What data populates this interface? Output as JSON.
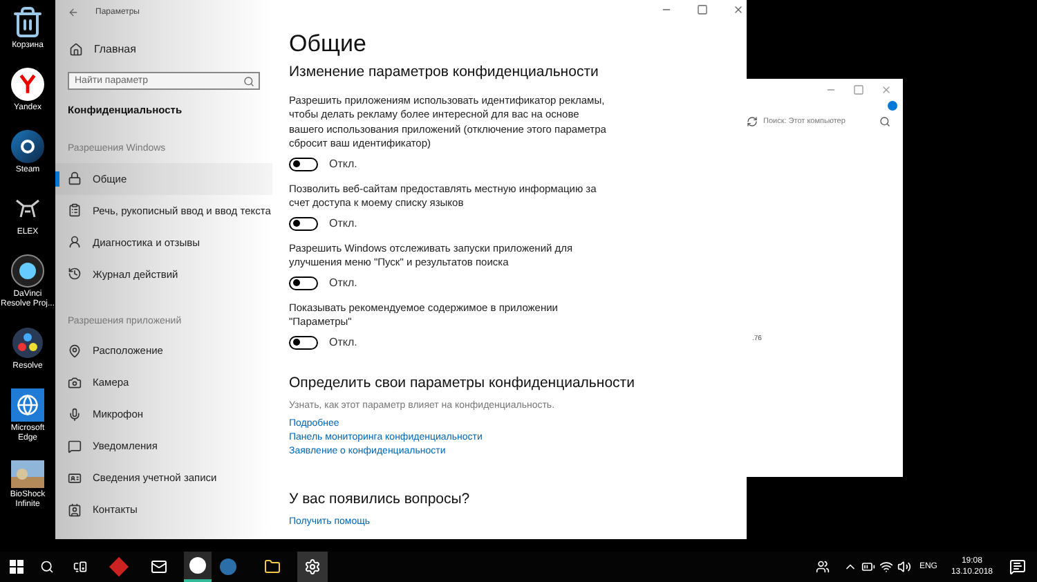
{
  "desktop_icons": [
    {
      "label": "Корзина",
      "kind": "bin"
    },
    {
      "label": "Yandex",
      "kind": "yandex"
    },
    {
      "label": "Steam",
      "kind": "steam"
    },
    {
      "label": "ELEX",
      "kind": "elex"
    },
    {
      "label": "DaVinci Resolve Proj...",
      "kind": "davinci"
    },
    {
      "label": "Resolve",
      "kind": "resolve"
    },
    {
      "label": "Microsoft Edge",
      "kind": "edge"
    },
    {
      "label": "BioShock Infinite",
      "kind": "picture"
    }
  ],
  "window": {
    "title": "Параметры"
  },
  "sidebar": {
    "home": "Главная",
    "search": {
      "placeholder": "Найти параметр"
    },
    "heading": "Конфиденциальность",
    "sections": [
      {
        "title": "Разрешения Windows",
        "items": [
          {
            "label": "Общие",
            "selected": true
          },
          {
            "label": "Речь, рукописный ввод и ввод текста",
            "selected": false
          },
          {
            "label": "Диагностика и отзывы",
            "selected": false
          },
          {
            "label": "Журнал действий",
            "selected": false
          }
        ]
      },
      {
        "title": "Разрешения приложений",
        "items": [
          {
            "label": "Расположение",
            "selected": false
          },
          {
            "label": "Камера",
            "selected": false
          },
          {
            "label": "Микрофон",
            "selected": false
          },
          {
            "label": "Уведомления",
            "selected": false
          },
          {
            "label": "Сведения учетной записи",
            "selected": false
          },
          {
            "label": "Контакты",
            "selected": false
          }
        ]
      }
    ]
  },
  "content": {
    "title": "Общие",
    "subtitle": "Изменение параметров конфиденциальности",
    "settings": [
      {
        "description": "Разрешить приложениям использовать идентификатор рекламы, чтобы делать рекламу более интересной для вас на основе вашего использования приложений (отключение этого параметра сбросит ваш идентификатор)",
        "on": false,
        "state": "Откл."
      },
      {
        "description": "Позволить веб-сайтам предоставлять местную информацию за счет доступа к моему списку языков",
        "on": false,
        "state": "Откл."
      },
      {
        "description": "Разрешить Windows отслеживать запуски приложений для улучшения меню \"Пуск\" и результатов поиска",
        "on": false,
        "state": "Откл."
      },
      {
        "description": "Показывать рекомендуемое содержимое в приложении \"Параметры\"",
        "on": false,
        "state": "Откл."
      }
    ],
    "privacy_section": {
      "title": "Определить свои параметры конфиденциальности",
      "description": "Узнать, как этот параметр влияет на конфиденциальность.",
      "links": [
        "Подробнее",
        "Панель мониторинга конфиденциальности",
        "Заявление о конфиденциальности"
      ]
    },
    "help_section": {
      "title": "У вас появились вопросы?",
      "links": [
        "Получить помощь"
      ]
    }
  },
  "explorer": {
    "search": {
      "placeholder": "Поиск: Этот компьютер"
    },
    "fragment": ".76"
  },
  "taskbar": {
    "language": "ENG",
    "time": "19:08",
    "date": "13.10.2018"
  }
}
